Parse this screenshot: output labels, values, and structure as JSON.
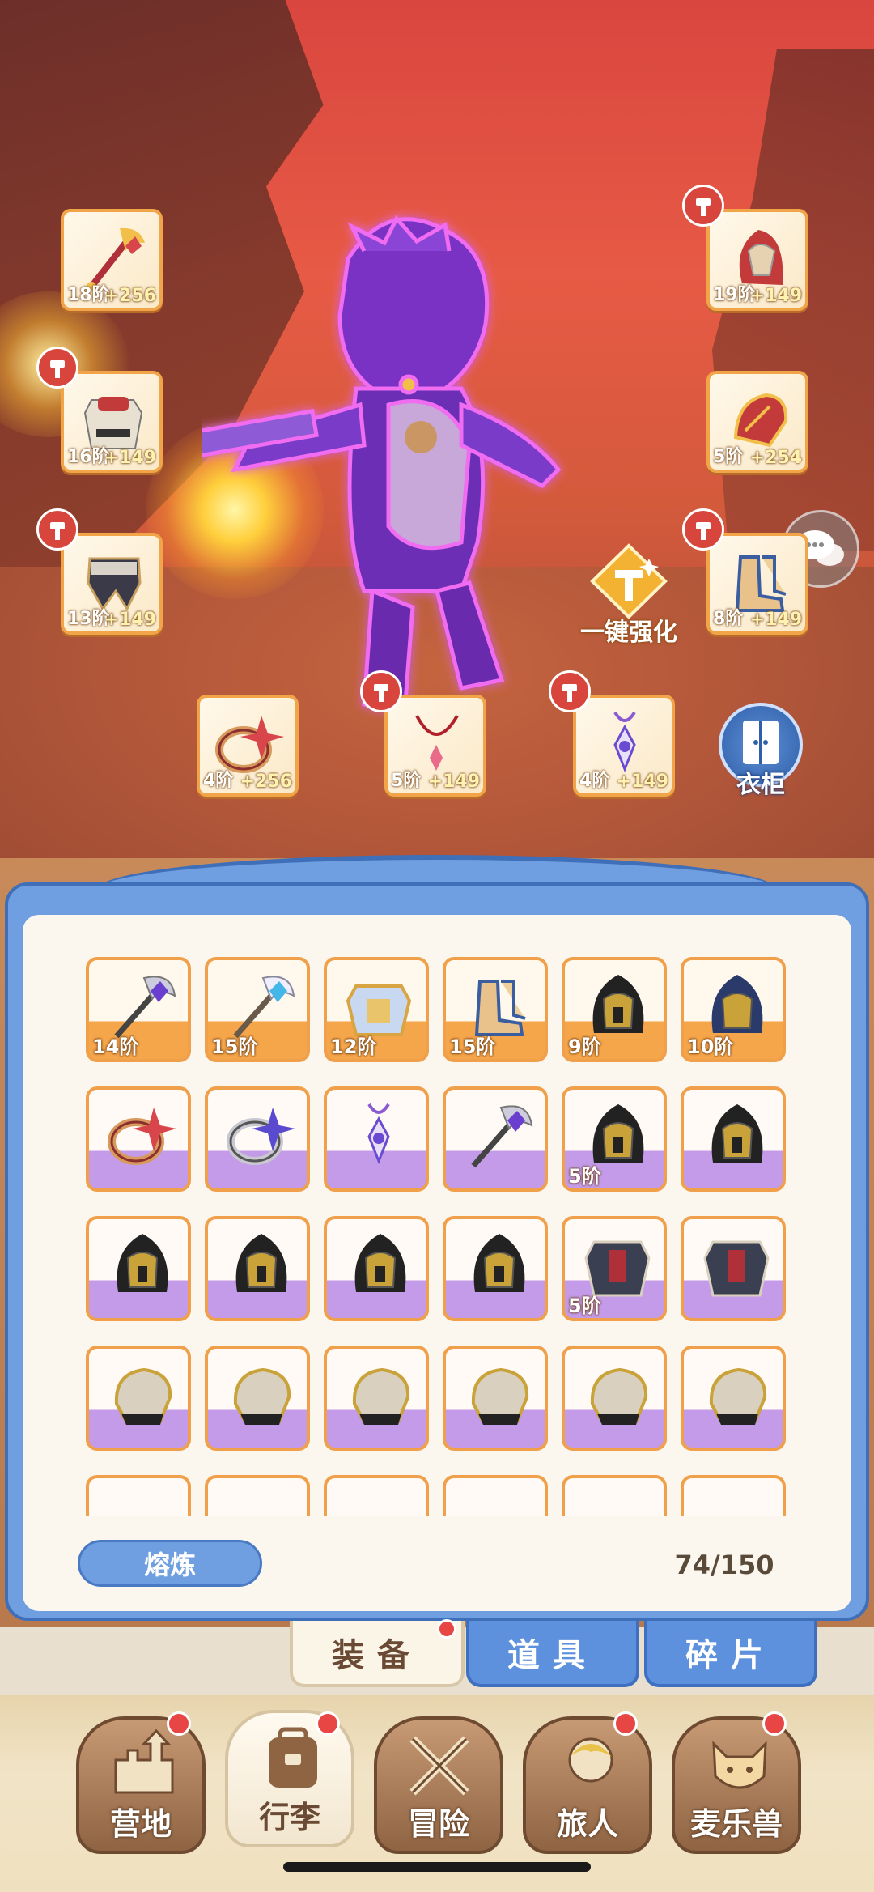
{
  "equipment": {
    "slots": [
      {
        "id": "weapon",
        "level": "18阶",
        "bonus": "+256",
        "hammer": false
      },
      {
        "id": "chest",
        "level": "16阶",
        "bonus": "+149",
        "hammer": true
      },
      {
        "id": "pants",
        "level": "13阶",
        "bonus": "+149",
        "hammer": true
      },
      {
        "id": "helmet",
        "level": "19阶",
        "bonus": "+149",
        "hammer": true
      },
      {
        "id": "gloves",
        "level": "5阶",
        "bonus": "+254",
        "hammer": false
      },
      {
        "id": "boots",
        "level": "8阶",
        "bonus": "+149",
        "hammer": true
      },
      {
        "id": "ring",
        "level": "4阶",
        "bonus": "+256",
        "hammer": false
      },
      {
        "id": "necklace",
        "level": "5阶",
        "bonus": "+149",
        "hammer": true
      },
      {
        "id": "amulet",
        "level": "4阶",
        "bonus": "+149",
        "hammer": true
      }
    ],
    "upgrade_all_label": "一键强化",
    "wardrobe_label": "衣柜"
  },
  "inventory": {
    "items": [
      {
        "type": "staff",
        "level": "14阶",
        "bg": "orange"
      },
      {
        "type": "staff-blue",
        "level": "15阶",
        "bg": "orange"
      },
      {
        "type": "armor-gold",
        "level": "12阶",
        "bg": "orange"
      },
      {
        "type": "boots",
        "level": "15阶",
        "bg": "orange"
      },
      {
        "type": "helmet-dark",
        "level": "9阶",
        "bg": "orange"
      },
      {
        "type": "helmet-blue",
        "level": "10阶",
        "bg": "orange"
      },
      {
        "type": "ring",
        "level": "",
        "bg": "purple"
      },
      {
        "type": "ring-silver",
        "level": "",
        "bg": "purple"
      },
      {
        "type": "amulet",
        "level": "",
        "bg": "purple"
      },
      {
        "type": "staff",
        "level": "",
        "bg": "purple"
      },
      {
        "type": "helmet-dark",
        "level": "5阶",
        "bg": "purple"
      },
      {
        "type": "helmet-dark",
        "level": "",
        "bg": "purple"
      },
      {
        "type": "helmet-dark",
        "level": "",
        "bg": "purple"
      },
      {
        "type": "helmet-dark",
        "level": "",
        "bg": "purple"
      },
      {
        "type": "helmet-dark",
        "level": "",
        "bg": "purple"
      },
      {
        "type": "helmet-dark",
        "level": "",
        "bg": "purple"
      },
      {
        "type": "armor-dark",
        "level": "5阶",
        "bg": "purple"
      },
      {
        "type": "armor-dark",
        "level": "",
        "bg": "purple"
      },
      {
        "type": "gauntlet",
        "level": "",
        "bg": "purple"
      },
      {
        "type": "gauntlet",
        "level": "",
        "bg": "purple"
      },
      {
        "type": "gauntlet",
        "level": "",
        "bg": "purple"
      },
      {
        "type": "gauntlet",
        "level": "",
        "bg": "purple"
      },
      {
        "type": "gauntlet",
        "level": "",
        "bg": "purple"
      },
      {
        "type": "gauntlet",
        "level": "",
        "bg": "purple"
      },
      {
        "type": "partial",
        "level": "",
        "bg": "purple"
      },
      {
        "type": "partial",
        "level": "",
        "bg": "purple"
      },
      {
        "type": "partial",
        "level": "",
        "bg": "purple"
      },
      {
        "type": "partial",
        "level": "",
        "bg": "purple"
      },
      {
        "type": "partial",
        "level": "",
        "bg": "purple"
      },
      {
        "type": "partial",
        "level": "",
        "bg": "purple"
      }
    ],
    "smelt_label": "熔炼",
    "capacity": "74/150"
  },
  "tabs": [
    {
      "label": "装备",
      "active": true,
      "badge": true
    },
    {
      "label": "道具",
      "active": false,
      "badge": false
    },
    {
      "label": "碎片",
      "active": false,
      "badge": false
    }
  ],
  "nav": [
    {
      "label": "营地",
      "icon": "castle-icon",
      "badge": true,
      "active": false
    },
    {
      "label": "行李",
      "icon": "backpack-icon",
      "badge": true,
      "active": true
    },
    {
      "label": "冒险",
      "icon": "crossed-swords-icon",
      "badge": false,
      "active": false
    },
    {
      "label": "旅人",
      "icon": "character-icon",
      "badge": true,
      "active": false
    },
    {
      "label": "麦乐兽",
      "icon": "cat-icon",
      "badge": true,
      "active": false
    }
  ],
  "colors": {
    "accent_blue": "#6f9fe0",
    "badge_red": "#e84545",
    "frame_orange": "#f0a04a"
  }
}
